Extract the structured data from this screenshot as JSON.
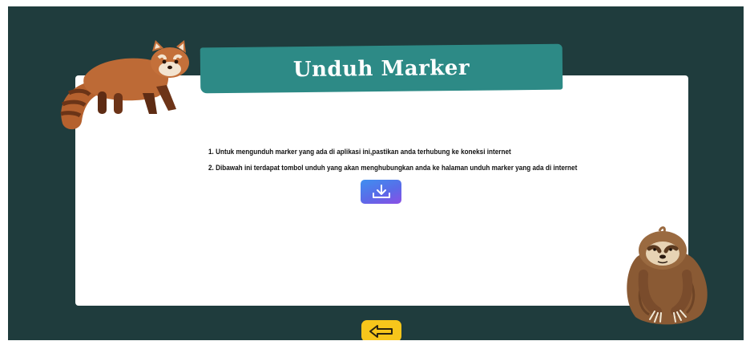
{
  "page": {
    "title": "Unduh Marker",
    "instructions": [
      "1. Untuk mengunduh marker yang ada di aplikasi ini,pastikan anda terhubung ke koneksi internet",
      "2. Dibawah ini terdapat tombol unduh yang akan menghubungkan anda ke halaman unduh marker yang ada di internet"
    ]
  },
  "buttons": {
    "download_icon": "download-icon",
    "back_icon": "arrow-left-icon"
  },
  "colors": {
    "background": "#1f3c3d",
    "banner": "#2d8a86",
    "back_button": "#f7c61b",
    "download_gradient_start": "#3f8ff0",
    "download_gradient_end": "#8b4fe6"
  },
  "decorations": {
    "left": "red-panda-illustration",
    "right": "sloth-illustration"
  }
}
